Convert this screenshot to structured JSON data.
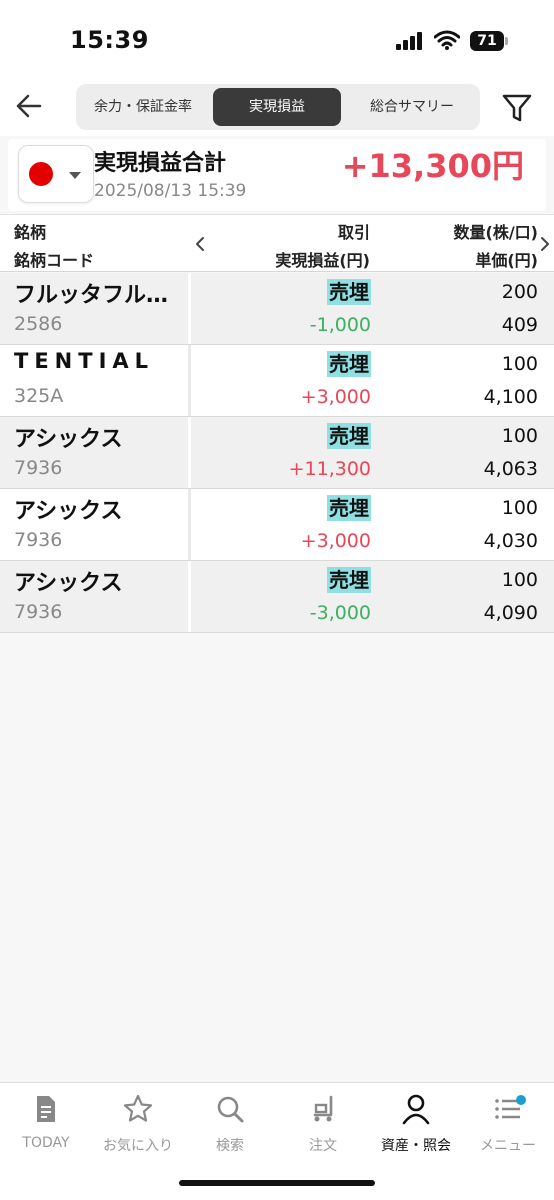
{
  "status_bar": {
    "time": "15:39",
    "battery": "71",
    "icons": [
      "cellular-signal-icon",
      "wifi-icon",
      "battery-icon"
    ]
  },
  "header": {
    "back_icon": "arrow-left-icon",
    "tabs": [
      {
        "label": "余力・保証金率",
        "selected": false
      },
      {
        "label": "実現損益",
        "selected": true
      },
      {
        "label": "総合サマリー",
        "selected": false
      }
    ],
    "filter_icon": "filter-icon"
  },
  "summary": {
    "market_flag": "japan-flag-icon",
    "title": "実現損益合計",
    "datetime": "2025/08/13 15:39",
    "total": "+13,300円"
  },
  "table": {
    "headers": {
      "name": "銘柄",
      "code": "銘柄コード",
      "trade": "取引",
      "pl": "実現損益(円)",
      "qty": "数量(株/口)",
      "price": "単価(円)"
    },
    "rows": [
      {
        "name": "フルッタフル…",
        "code": "2586",
        "trade": "売埋",
        "pl": "-1,000",
        "qty": "200",
        "price": "409"
      },
      {
        "name": "TENTIAL",
        "code": "325A",
        "trade": "売埋",
        "pl": "+3,000",
        "qty": "100",
        "price": "4,100"
      },
      {
        "name": "アシックス",
        "code": "7936",
        "trade": "売埋",
        "pl": "+11,300",
        "qty": "100",
        "price": "4,063"
      },
      {
        "name": "アシックス",
        "code": "7936",
        "trade": "売埋",
        "pl": "+3,000",
        "qty": "100",
        "price": "4,030"
      },
      {
        "name": "アシックス",
        "code": "7936",
        "trade": "売埋",
        "pl": "-3,000",
        "qty": "100",
        "price": "4,090"
      }
    ]
  },
  "colors": {
    "positive": "#e6485a",
    "negative": "#3bb060",
    "trade_badge": "#8fe0e3",
    "active_tab": "#3a3a3a",
    "notification_dot": "#1a9fcf"
  },
  "tabbar": {
    "items": [
      {
        "label": "TODAY",
        "icon": "document-icon",
        "active": false
      },
      {
        "label": "お気に入り",
        "icon": "star-icon",
        "active": false
      },
      {
        "label": "検索",
        "icon": "search-icon",
        "active": false
      },
      {
        "label": "注文",
        "icon": "cart-icon",
        "active": false
      },
      {
        "label": "資産・照会",
        "icon": "person-icon",
        "active": true
      },
      {
        "label": "メニュー",
        "icon": "menu-icon",
        "active": false
      }
    ]
  }
}
